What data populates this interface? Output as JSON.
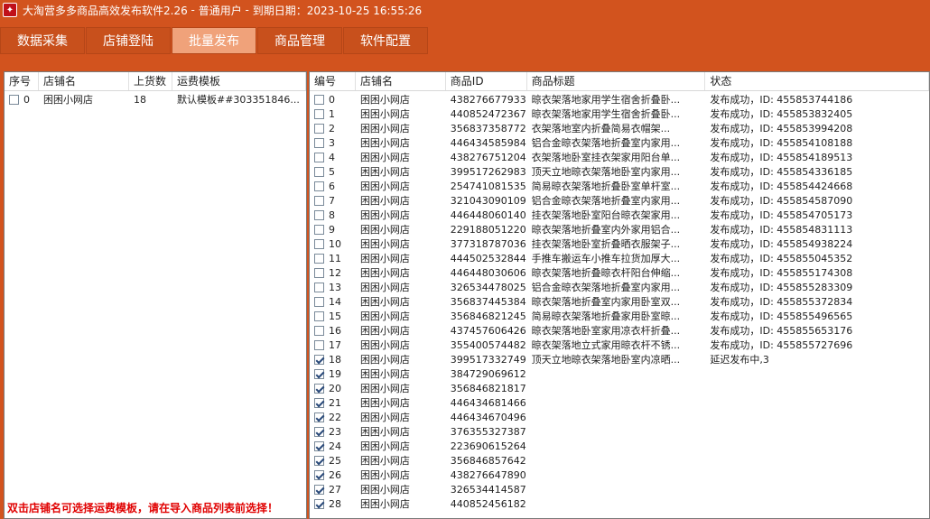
{
  "title": {
    "app_name": "大淘营多多商品高效发布软件2.26",
    "sep1": " - ",
    "user_type": "普通用户",
    "sep2": " - ",
    "expiry": "到期日期：2023-10-25 16:55:26"
  },
  "tabs": [
    {
      "label": "数据采集"
    },
    {
      "label": "店铺登陆"
    },
    {
      "label": "批量发布"
    },
    {
      "label": "商品管理"
    },
    {
      "label": "软件配置"
    }
  ],
  "left_table": {
    "headers": [
      "序号",
      "店铺名",
      "上货数",
      "运费模板"
    ],
    "rows": [
      {
        "idx": "0",
        "shop": "困困小网店",
        "count": "18",
        "template": "默认模板##303351846..."
      }
    ]
  },
  "right_table": {
    "headers": [
      "编号",
      "店铺名",
      "商品ID",
      "商品标题",
      "状态"
    ],
    "rows": [
      {
        "no": "0",
        "checked": false,
        "shop": "困困小网店",
        "pid": "438276677933",
        "title": "晾衣架落地家用学生宿舍折叠卧...",
        "status": "发布成功，ID: 455853744186"
      },
      {
        "no": "1",
        "checked": false,
        "shop": "困困小网店",
        "pid": "440852472367",
        "title": "晾衣架落地家用学生宿舍折叠卧...",
        "status": "发布成功，ID: 455853832405"
      },
      {
        "no": "2",
        "checked": false,
        "shop": "困困小网店",
        "pid": "356837358772",
        "title": "衣架落地室内折叠简易衣帽架...",
        "status": "发布成功，ID: 455853994208"
      },
      {
        "no": "3",
        "checked": false,
        "shop": "困困小网店",
        "pid": "446434585984",
        "title": "铝合金晾衣架落地折叠室内家用...",
        "status": "发布成功，ID: 455854108188"
      },
      {
        "no": "4",
        "checked": false,
        "shop": "困困小网店",
        "pid": "438276751204",
        "title": "衣架落地卧室挂衣架家用阳台单...",
        "status": "发布成功，ID: 455854189513"
      },
      {
        "no": "5",
        "checked": false,
        "shop": "困困小网店",
        "pid": "399517262983",
        "title": "顶天立地晾衣架落地卧室内家用...",
        "status": "发布成功，ID: 455854336185"
      },
      {
        "no": "6",
        "checked": false,
        "shop": "困困小网店",
        "pid": "254741081535",
        "title": "简易晾衣架落地折叠卧室单杆室...",
        "status": "发布成功，ID: 455854424668"
      },
      {
        "no": "7",
        "checked": false,
        "shop": "困困小网店",
        "pid": "321043090109",
        "title": "铝合金晾衣架落地折叠室内家用...",
        "status": "发布成功，ID: 455854587090"
      },
      {
        "no": "8",
        "checked": false,
        "shop": "困困小网店",
        "pid": "446448060140",
        "title": "挂衣架落地卧室阳台晾衣架家用...",
        "status": "发布成功，ID: 455854705173"
      },
      {
        "no": "9",
        "checked": false,
        "shop": "困困小网店",
        "pid": "229188051220",
        "title": "晾衣架落地折叠室内外家用铝合...",
        "status": "发布成功，ID: 455854831113"
      },
      {
        "no": "10",
        "checked": false,
        "shop": "困困小网店",
        "pid": "377318787036",
        "title": "挂衣架落地卧室折叠晒衣服架子...",
        "status": "发布成功，ID: 455854938224"
      },
      {
        "no": "11",
        "checked": false,
        "shop": "困困小网店",
        "pid": "444502532844",
        "title": "手推车搬运车小推车拉货加厚大...",
        "status": "发布成功，ID: 455855045352"
      },
      {
        "no": "12",
        "checked": false,
        "shop": "困困小网店",
        "pid": "446448030606",
        "title": "晾衣架落地折叠晾衣杆阳台伸缩...",
        "status": "发布成功，ID: 455855174308"
      },
      {
        "no": "13",
        "checked": false,
        "shop": "困困小网店",
        "pid": "326534478025",
        "title": "铝合金晾衣架落地折叠室内家用...",
        "status": "发布成功，ID: 455855283309"
      },
      {
        "no": "14",
        "checked": false,
        "shop": "困困小网店",
        "pid": "356837445384",
        "title": "晾衣架落地折叠室内家用卧室双...",
        "status": "发布成功，ID: 455855372834"
      },
      {
        "no": "15",
        "checked": false,
        "shop": "困困小网店",
        "pid": "356846821245",
        "title": "简易晾衣架落地折叠家用卧室晾...",
        "status": "发布成功，ID: 455855496565"
      },
      {
        "no": "16",
        "checked": false,
        "shop": "困困小网店",
        "pid": "437457606426",
        "title": "晾衣架落地卧室家用凉衣杆折叠...",
        "status": "发布成功，ID: 455855653176"
      },
      {
        "no": "17",
        "checked": false,
        "shop": "困困小网店",
        "pid": "355400574482",
        "title": "晾衣架落地立式家用晾衣杆不锈...",
        "status": "发布成功，ID: 455855727696"
      },
      {
        "no": "18",
        "checked": true,
        "shop": "困困小网店",
        "pid": "399517332749",
        "title": "顶天立地晾衣架落地卧室内凉晒...",
        "status": "延迟发布中,3"
      },
      {
        "no": "19",
        "checked": true,
        "shop": "困困小网店",
        "pid": "384729069612",
        "title": "",
        "status": ""
      },
      {
        "no": "20",
        "checked": true,
        "shop": "困困小网店",
        "pid": "356846821817",
        "title": "",
        "status": ""
      },
      {
        "no": "21",
        "checked": true,
        "shop": "困困小网店",
        "pid": "446434681466",
        "title": "",
        "status": ""
      },
      {
        "no": "22",
        "checked": true,
        "shop": "困困小网店",
        "pid": "446434670496",
        "title": "",
        "status": ""
      },
      {
        "no": "23",
        "checked": true,
        "shop": "困困小网店",
        "pid": "376355327387",
        "title": "",
        "status": ""
      },
      {
        "no": "24",
        "checked": true,
        "shop": "困困小网店",
        "pid": "223690615264",
        "title": "",
        "status": ""
      },
      {
        "no": "25",
        "checked": true,
        "shop": "困困小网店",
        "pid": "356846857642",
        "title": "",
        "status": ""
      },
      {
        "no": "26",
        "checked": true,
        "shop": "困困小网店",
        "pid": "438276647890",
        "title": "",
        "status": ""
      },
      {
        "no": "27",
        "checked": true,
        "shop": "困困小网店",
        "pid": "326534414587",
        "title": "",
        "status": ""
      },
      {
        "no": "28",
        "checked": true,
        "shop": "困困小网店",
        "pid": "440852456182",
        "title": "",
        "status": ""
      }
    ]
  },
  "hint": "双击店铺名可选择运费模板，请在导入商品列表前选择！",
  "colors": {
    "accent": "#d2531e",
    "active_tab": "#f0a27a",
    "hint": "#e00000"
  }
}
